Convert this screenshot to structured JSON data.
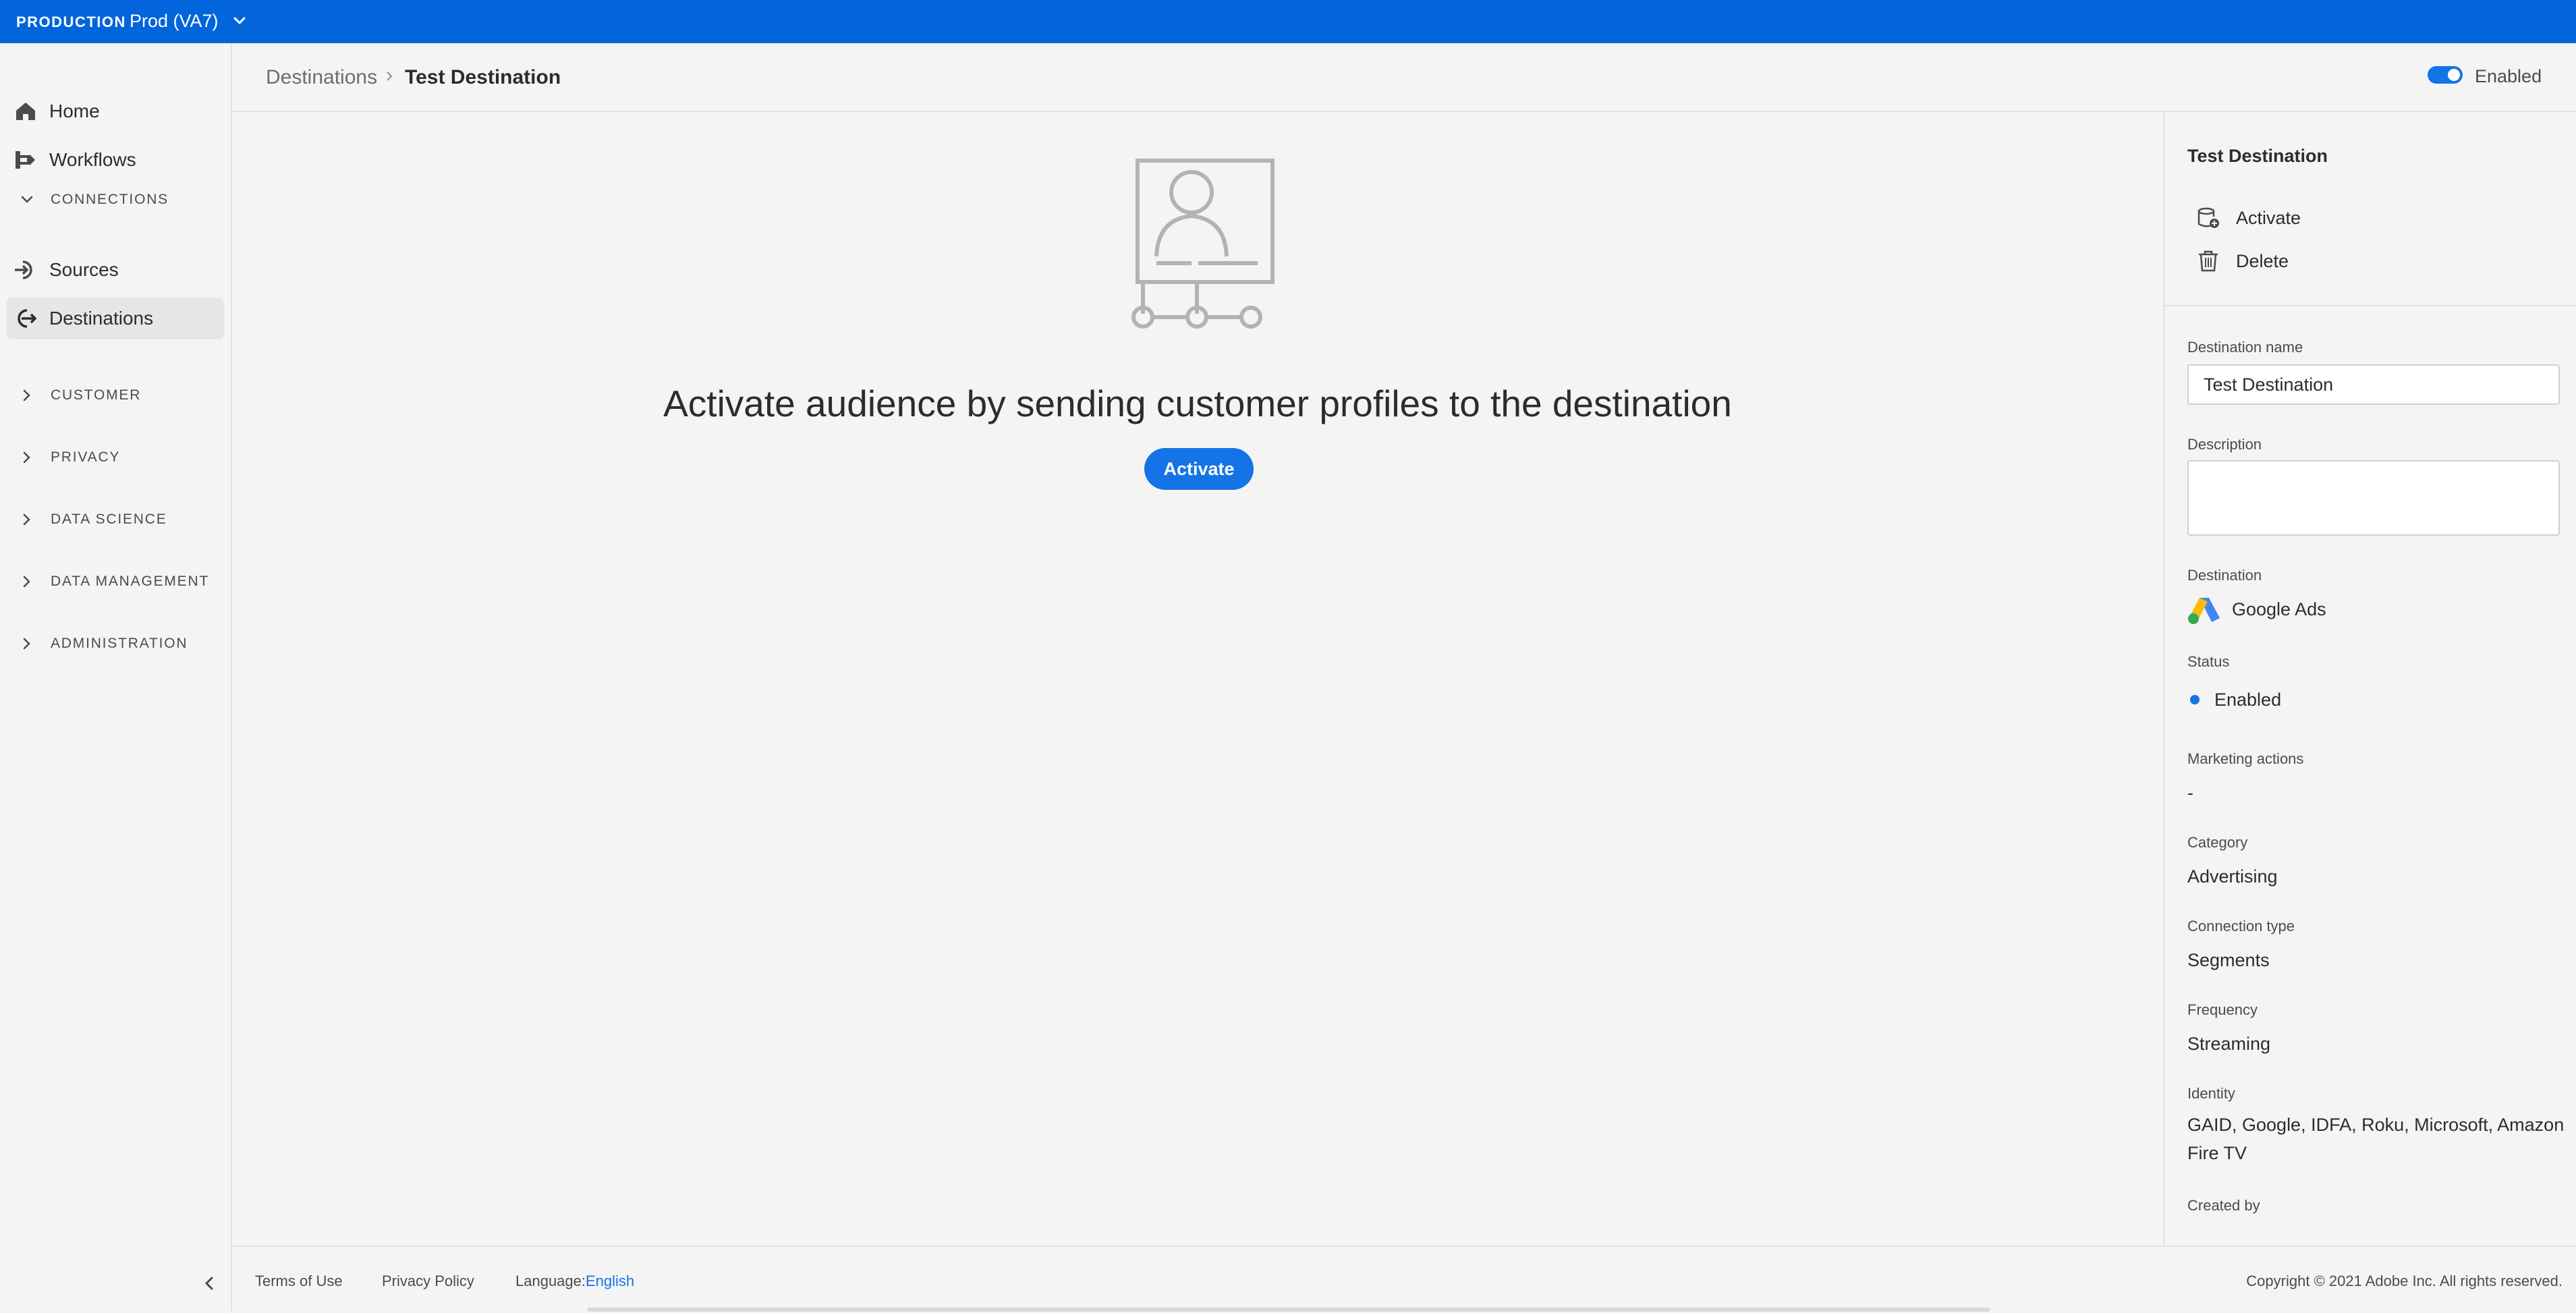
{
  "topbar": {
    "env_label": "PRODUCTION",
    "sandbox": "Prod (VA7)"
  },
  "sidebar": {
    "home": "Home",
    "workflows": "Workflows",
    "sections": {
      "connections": "CONNECTIONS",
      "customer": "CUSTOMER",
      "privacy": "PRIVACY",
      "data_science": "DATA SCIENCE",
      "data_management": "DATA MANAGEMENT",
      "administration": "ADMINISTRATION"
    },
    "sources": "Sources",
    "destinations": "Destinations",
    "selected": "Destinations"
  },
  "header": {
    "breadcrumb_parent": "Destinations",
    "breadcrumb_current": "Test Destination",
    "toggle_label": "Enabled",
    "toggle_on": true
  },
  "main": {
    "message": "Activate audience by sending customer profiles to the destination",
    "activate_button": "Activate"
  },
  "rail": {
    "title": "Test Destination",
    "actions": {
      "activate": "Activate",
      "delete": "Delete"
    },
    "fields": {
      "destination_name_label": "Destination name",
      "destination_name_value": "Test Destination",
      "description_label": "Description",
      "description_value": "",
      "destination_label": "Destination",
      "destination_value": "Google Ads",
      "status_label": "Status",
      "status_value": "Enabled",
      "marketing_label": "Marketing actions",
      "marketing_value": "-",
      "category_label": "Category",
      "category_value": "Advertising",
      "connection_type_label": "Connection type",
      "connection_type_value": "Segments",
      "frequency_label": "Frequency",
      "frequency_value": "Streaming",
      "identity_label": "Identity",
      "identity_value": "GAID, Google, IDFA, Roku, Microsoft, Amazon Fire TV",
      "created_by_label": "Created by"
    }
  },
  "footer": {
    "terms": "Terms of Use",
    "privacy": "Privacy Policy",
    "language_label": "Language:",
    "language_value": "English",
    "copyright": "Copyright © 2021 Adobe Inc. All rights reserved."
  },
  "colors": {
    "brand_blue": "#0265dc",
    "accent": "#1473e6"
  }
}
